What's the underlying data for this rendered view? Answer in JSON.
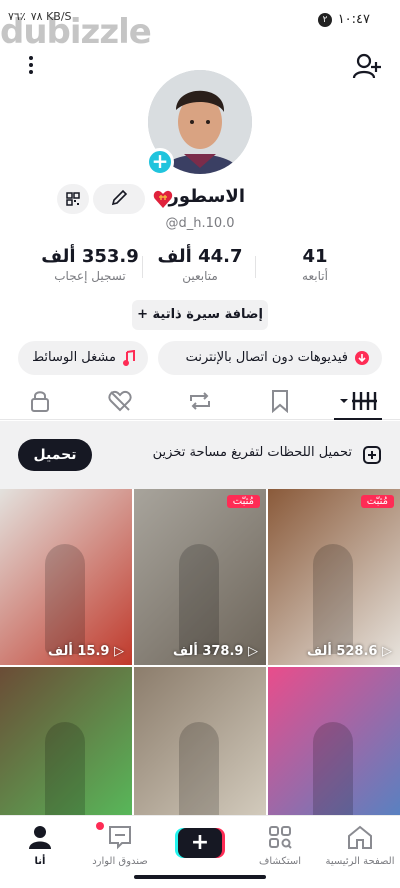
{
  "status_bar": {
    "time": "١٠:٤٧",
    "notification_count": "٢",
    "left_info": "٧٦٪",
    "speed": "٧٨ KB/S"
  },
  "watermark": "dubizzle",
  "profile": {
    "display_name": "الاسطوره",
    "username": "@d_h.10.0",
    "bio_button": "إضافة سيرة ذاتية",
    "bio_plus": "+"
  },
  "stats": [
    {
      "value": "41",
      "label": "أتابعه"
    },
    {
      "value": "44.7 ألف",
      "label": "متابعين"
    },
    {
      "value": "353.9 ألف",
      "label": "تسجيل إعجاب"
    }
  ],
  "chips": {
    "offline_videos": "فيديوهات دون اتصال بالإنترنت",
    "media_player": "مشغل الوسائط"
  },
  "banner": {
    "text": "تحميل اللحظات لتفريغ مساحة تخزين",
    "button": "تحميل"
  },
  "videos": [
    {
      "views": "528.6 ألف",
      "pinned": "مُثبّت",
      "colors": [
        "#8a5a3a",
        "#e8e4de"
      ]
    },
    {
      "views": "378.9 ألف",
      "pinned": "مُثبّت",
      "colors": [
        "#a8a49c",
        "#6d655a"
      ]
    },
    {
      "views": "15.9 ألف",
      "pinned": "",
      "colors": [
        "#e3e1dd",
        "#c0392b"
      ]
    },
    {
      "views": "",
      "pinned": "",
      "colors": [
        "#e94d8b",
        "#4b86c6"
      ]
    },
    {
      "views": "",
      "pinned": "",
      "colors": [
        "#8c7d6c",
        "#d9d2c4"
      ]
    },
    {
      "views": "",
      "pinned": "",
      "colors": [
        "#6b4c36",
        "#56c25d"
      ]
    }
  ],
  "bottom_nav": {
    "home": "الصفحة الرئيسية",
    "discover": "استكشاف",
    "create": "+",
    "inbox": "صندوق الوارد",
    "me": "أنا"
  },
  "colors": {
    "accent": "#fe2c55",
    "cyan": "#20c4dd",
    "text": "#161823",
    "muted": "#7a7b80",
    "chip_bg": "#f1f1f2"
  }
}
